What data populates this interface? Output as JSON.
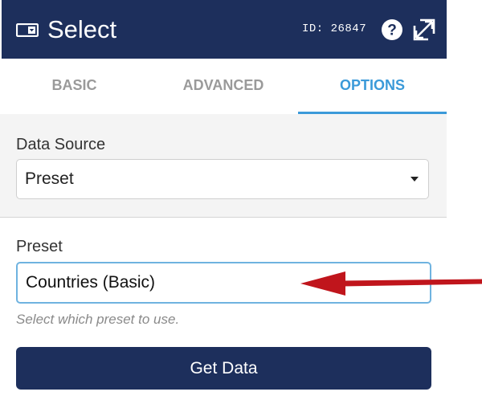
{
  "header": {
    "title": "Select",
    "id_label": "ID: 26847",
    "type_icon": "select-field-icon",
    "help_icon": "question-circle-icon",
    "expand_icon": "expand-arrows-icon",
    "background_color": "#1d2f5c"
  },
  "tabs": [
    {
      "label": "BASIC",
      "active": false
    },
    {
      "label": "ADVANCED",
      "active": false
    },
    {
      "label": "OPTIONS",
      "active": true
    }
  ],
  "accent_color": "#3b9ad9",
  "data_source": {
    "label": "Data Source",
    "value": "Preset",
    "caret_icon": "caret-down-icon"
  },
  "preset": {
    "label": "Preset",
    "value": "Countries (Basic)",
    "help_text": "Select which preset to use.",
    "caret_icon": "caret-down-icon"
  },
  "get_data_button": {
    "label": "Get Data"
  },
  "annotation": {
    "icon": "red-arrow-pointer",
    "color": "#c0151c"
  }
}
